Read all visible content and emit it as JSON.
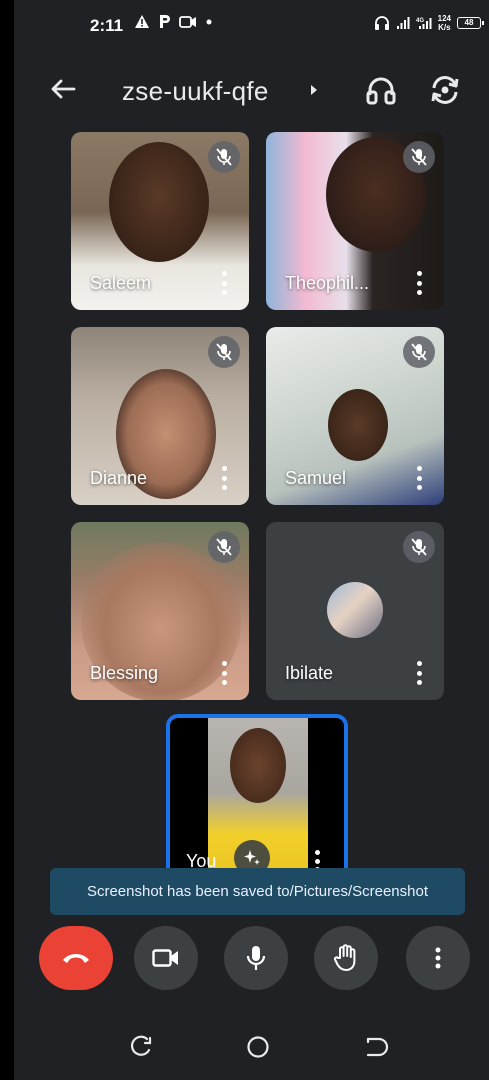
{
  "status_bar": {
    "time": "2:11",
    "left_icons": [
      "warning-icon",
      "parking-icon",
      "video-record-icon",
      "dot-icon"
    ],
    "right_icons": [
      "headset-icon",
      "signal-icon",
      "4g-signal-icon"
    ],
    "network_speed_value": "124",
    "network_speed_unit": "K/s",
    "battery": "48"
  },
  "top_bar": {
    "meeting_code": "zse-uukf-qfe",
    "icons": [
      "back-arrow-icon",
      "headset-icon",
      "switch-camera-icon"
    ]
  },
  "participants": [
    {
      "name": "Saleem",
      "muted": true
    },
    {
      "name": "Theophil...",
      "muted": true
    },
    {
      "name": "Dianne",
      "muted": true
    },
    {
      "name": "Samuel",
      "muted": true
    },
    {
      "name": "Blessing",
      "muted": true
    },
    {
      "name": "Ibilate",
      "muted": true,
      "video": false
    }
  ],
  "self_tile": {
    "name": "You",
    "effects_icon": "sparkle-icon"
  },
  "toast": {
    "message": "Screenshot has been saved to/Pictures/Screenshot"
  },
  "controls": {
    "end_call_icon": "hang-up-icon",
    "camera_icon": "video-camera-icon",
    "mic_icon": "microphone-icon",
    "raise_hand_icon": "hand-icon",
    "more_icon": "more-vert-icon"
  },
  "colors": {
    "background": "#202124",
    "end_call": "#ea4335",
    "control": "#3c4043",
    "active_speaker_border": "#1a73e8",
    "toast": "#1f4a63"
  }
}
